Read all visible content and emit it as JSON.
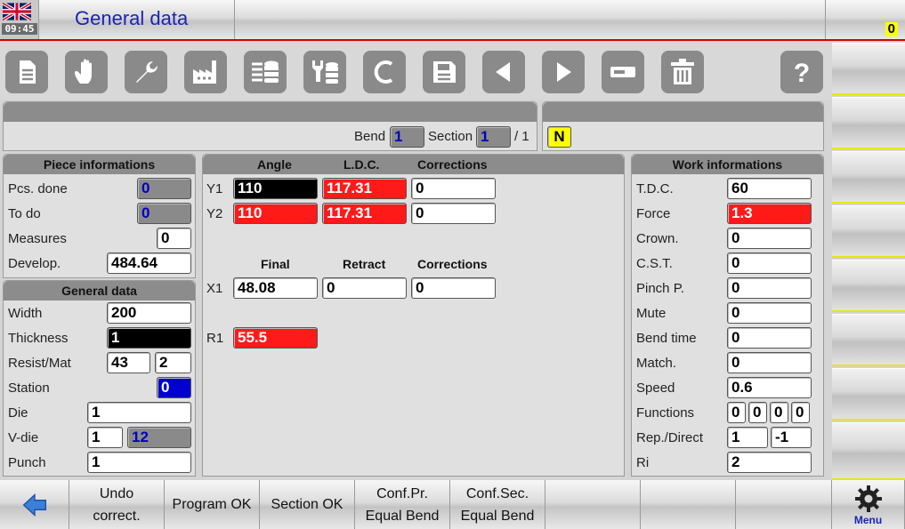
{
  "header": {
    "time": "09:45",
    "title": "General data",
    "counter": "0"
  },
  "toolbar": {
    "icons": [
      "document-icon",
      "hand-icon",
      "wrench-icon",
      "factory-icon",
      "database-list-icon",
      "tool-database-icon",
      "c-icon",
      "save-icon",
      "arrow-left-icon",
      "arrow-right-icon",
      "minus-icon",
      "trash-icon",
      "help-icon"
    ]
  },
  "bend_bar": {
    "bend_label": "Bend",
    "bend_value": "1",
    "section_label": "Section",
    "section_value": "1",
    "section_total": "/ 1",
    "mode_badge": "N"
  },
  "piece_info": {
    "title": "Piece informations",
    "rows": [
      {
        "label": "Pcs. done",
        "value": "0"
      },
      {
        "label": "To do",
        "value": "0"
      },
      {
        "label": "Measures",
        "value": "0"
      },
      {
        "label": "Develop.",
        "value": "484.64"
      }
    ]
  },
  "general_data": {
    "title": "General data",
    "width_label": "Width",
    "width": "200",
    "thickness_label": "Thickness",
    "thickness": "1",
    "resist_label": "Resist/Mat",
    "resist": "43",
    "mat": "2",
    "station_label": "Station",
    "station": "0",
    "die_label": "Die",
    "die": "1",
    "vdie_label": "V-die",
    "vdie_a": "1",
    "vdie_b": "12",
    "punch_label": "Punch",
    "punch": "1"
  },
  "axes": {
    "angle_head": "Angle",
    "ldc_head": "L.D.C.",
    "corr_head": "Corrections",
    "y1_label": "Y1",
    "y1_angle": "110",
    "y1_ldc": "117.31",
    "y1_corr": "0",
    "y2_label": "Y2",
    "y2_angle": "110",
    "y2_ldc": "117.31",
    "y2_corr": "0",
    "final_head": "Final",
    "retract_head": "Retract",
    "corr2_head": "Corrections",
    "x1_label": "X1",
    "x1_final": "48.08",
    "x1_retract": "0",
    "x1_corr": "0",
    "r1_label": "R1",
    "r1_final": "55.5"
  },
  "work_info": {
    "title": "Work informations",
    "rows": [
      {
        "label": "T.D.C.",
        "value": "60"
      },
      {
        "label": "Force",
        "value": "1.3"
      },
      {
        "label": "Crown.",
        "value": "0"
      },
      {
        "label": "C.S.T.",
        "value": "0"
      },
      {
        "label": "Pinch P.",
        "value": "0"
      },
      {
        "label": "Mute",
        "value": "0"
      },
      {
        "label": "Bend time",
        "value": "0"
      },
      {
        "label": "Match.",
        "value": "0"
      },
      {
        "label": "Speed",
        "value": "0.6"
      }
    ],
    "functions_label": "Functions",
    "functions": [
      "0",
      "0",
      "0",
      "0"
    ],
    "rep_label": "Rep./Direct",
    "rep": "1",
    "direct": "-1",
    "ri_label": "Ri",
    "ri": "2"
  },
  "bottom": {
    "undo_l1": "Undo",
    "undo_l2": "correct.",
    "program_ok": "Program OK",
    "section_ok": "Section OK",
    "confpr_l1": "Conf.Pr.",
    "confpr_l2": "Equal Bend",
    "confsec_l1": "Conf.Sec.",
    "confsec_l2": "Equal Bend",
    "menu": "Menu"
  }
}
